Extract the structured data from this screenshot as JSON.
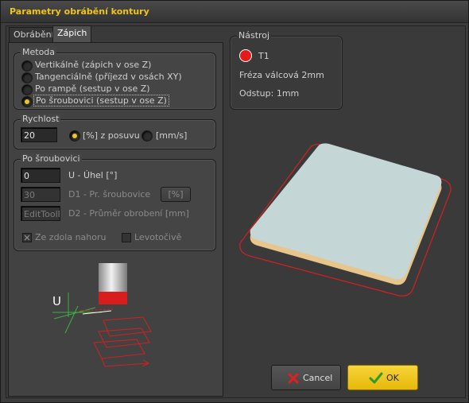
{
  "window": {
    "title": "Parametry obrábění kontury"
  },
  "tabs": [
    {
      "label": "Obrábění",
      "active": false
    },
    {
      "label": "Zápich",
      "active": true
    }
  ],
  "metoda": {
    "label": "Metoda",
    "options": [
      {
        "label": "Vertikálně (zápich v ose Z)",
        "selected": false
      },
      {
        "label": "Tangenciálně (příjezd v osách XY)",
        "selected": false
      },
      {
        "label": "Po rampě (sestup v ose Z)",
        "selected": false
      },
      {
        "label": "Po šroubovici (sestup v ose Z)",
        "selected": true
      }
    ]
  },
  "rychlost": {
    "label": "Rychlost",
    "value": "20",
    "options": [
      {
        "label": "[%] z posuvu",
        "selected": true
      },
      {
        "label": "[mm/s]",
        "selected": false
      }
    ]
  },
  "po_sroubovici": {
    "label": "Po šroubovici",
    "uhel_value": "0",
    "uhel_label": "U - Úhel [°]",
    "d1_value": "30",
    "d1_label": "D1 - Pr. šroubovice",
    "d1_unit_button": "[%]",
    "d2_value": "EditToolF",
    "d2_label": "D2 - Průměr obrobení  [mm]",
    "ze_zdola_label": "Ze zdola nahoru",
    "ze_zdola_checked": true,
    "levotocive_label": "Levotočivě",
    "levotocive_checked": false,
    "diagram_u_label": "U"
  },
  "nastroj": {
    "label": "Nástroj",
    "tool_id": "T1",
    "tool_color": "#e31b1b",
    "description": "Fréza válcová 2mm",
    "offset": "Odstup: 1mm"
  },
  "buttons": {
    "cancel": "Cancel",
    "ok": "OK"
  },
  "colors": {
    "accent": "#f0c419",
    "ok_button": "#f2c80f",
    "contour": "#d42020",
    "panel_top": "#c5d6d6",
    "panel_edge": "#e8c58a"
  }
}
